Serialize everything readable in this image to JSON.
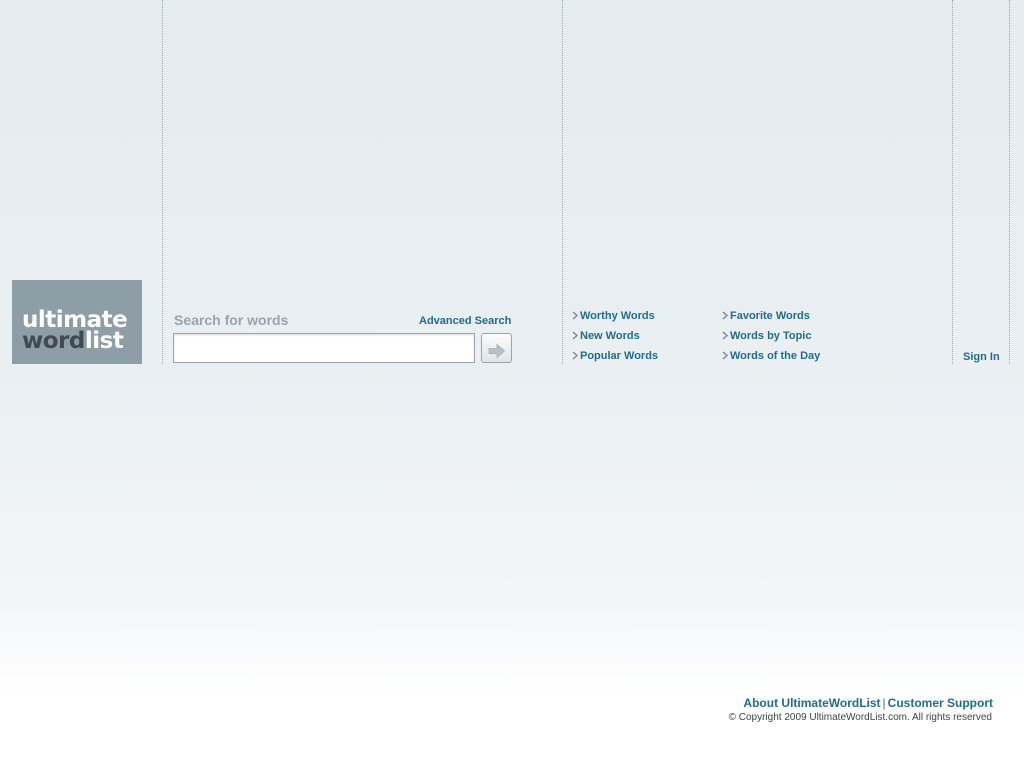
{
  "logo": {
    "line1": "ultimate",
    "line2_word": "word",
    "line2_list": "list"
  },
  "search": {
    "label": "Search for words",
    "advanced_label": "Advanced Search",
    "value": "",
    "placeholder": "",
    "button_icon": "arrow-right-icon"
  },
  "nav": {
    "col1": [
      {
        "label": "Worthy Words"
      },
      {
        "label": "New Words"
      },
      {
        "label": "Popular Words"
      }
    ],
    "col2": [
      {
        "label": "Favorite Words"
      },
      {
        "label": "Words by Topic"
      },
      {
        "label": "Words of the Day"
      }
    ],
    "bullet_icon": "chevron-right-icon"
  },
  "account": {
    "signin_label": "Sign In"
  },
  "footer": {
    "about_label": "About UltimateWordList",
    "separator": "|",
    "support_label": "Customer Support",
    "copyright": "© Copyright 2009 UltimateWordList.com. All rights reserved"
  },
  "colors": {
    "link": "#1f6d8a",
    "logo_bg": "#8e9ea6",
    "logo_dark": "#3f4a51",
    "label_gray": "#9aa5ab"
  }
}
